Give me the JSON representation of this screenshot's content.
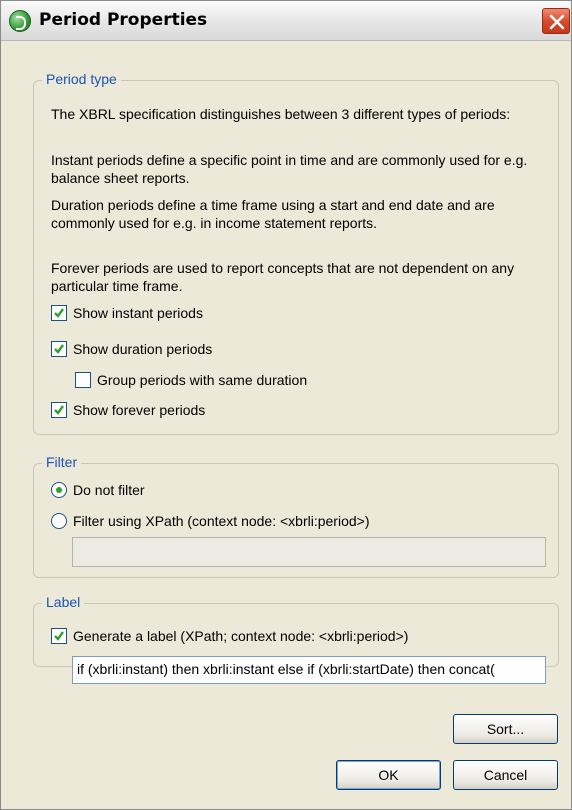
{
  "window": {
    "title": "Period Properties"
  },
  "period_type": {
    "legend": "Period type",
    "paragraphs": [
      "The XBRL specification distinguishes between 3 different types of periods:",
      "Instant periods define a specific point in time and are commonly used for e.g. balance sheet reports.",
      "Duration periods define a time frame using a start and end date and are commonly used for e.g. in income statement reports.",
      "Forever periods are used to report concepts that are not dependent on any particular time frame."
    ],
    "options": {
      "show_instant": {
        "label": "Show instant periods",
        "checked": true
      },
      "show_duration": {
        "label": "Show duration periods",
        "checked": true
      },
      "group_same_duration": {
        "label": "Group periods with same duration",
        "checked": false
      },
      "show_forever": {
        "label": "Show forever periods",
        "checked": true
      }
    }
  },
  "filter": {
    "legend": "Filter",
    "do_not_filter": {
      "label": "Do not filter",
      "selected": true
    },
    "filter_xpath": {
      "label": "Filter using XPath (context node: <xbrli:period>)",
      "selected": false
    },
    "xpath_value": ""
  },
  "label": {
    "legend": "Label",
    "generate": {
      "label": "Generate a label (XPath; context node: <xbrli:period>)",
      "checked": true
    },
    "xpath_value": "if (xbrli:instant) then xbrli:instant else if (xbrli:startDate) then concat("
  },
  "buttons": {
    "sort": "Sort...",
    "ok": "OK",
    "cancel": "Cancel"
  },
  "colors": {
    "dialog_bg": "#ece9d8",
    "legend_text": "#1c53b8",
    "check_green": "#2fa12f",
    "close_red": "#d6492a"
  }
}
